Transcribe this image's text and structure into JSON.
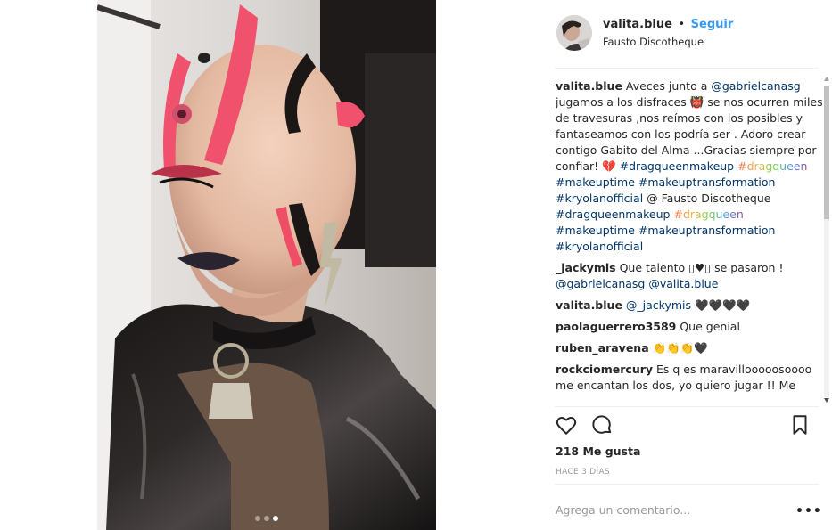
{
  "post": {
    "username": "valita.blue",
    "separator": "•",
    "follow_label": "Seguir",
    "location": "Fausto Discotheque",
    "carousel_dots": 3,
    "carousel_active": 3
  },
  "caption": {
    "user": "valita.blue",
    "segments": [
      {
        "t": " Aveces junto a "
      },
      {
        "t": "@gabrielcanasg",
        "k": "tag"
      },
      {
        "t": " jugamos a los disfraces 👹 se nos ocurren miles de travesuras ,nos reímos con los posibles y fantaseamos con los podría ser . Adoro crear contigo Gabito del Alma ...Gracias siempre por confiar! 💔 "
      },
      {
        "t": "#dragqueenmakeup",
        "k": "tag"
      },
      {
        "t": " "
      },
      {
        "t": "#dragqueen",
        "k": "rb"
      },
      {
        "t": " "
      },
      {
        "t": "#makeuptime",
        "k": "tag"
      },
      {
        "t": " "
      },
      {
        "t": "#makeuptransformation",
        "k": "tag"
      },
      {
        "t": " "
      },
      {
        "t": "#kryolanofficial",
        "k": "tag"
      },
      {
        "t": " @ Fausto Discotheque "
      },
      {
        "t": "#dragqueenmakeup",
        "k": "tag"
      },
      {
        "t": " "
      },
      {
        "t": "#dragqueen",
        "k": "rb"
      },
      {
        "t": " "
      },
      {
        "t": "#makeuptime",
        "k": "tag"
      },
      {
        "t": " "
      },
      {
        "t": "#makeuptransformation",
        "k": "tag"
      },
      {
        "t": " "
      },
      {
        "t": "#kryolanofficial",
        "k": "tag"
      }
    ]
  },
  "comments": [
    {
      "user": "_jackymis",
      "segments": [
        {
          "t": " Que talento ▯♥▯ se pasaron ! "
        },
        {
          "t": "@gabrielcanasg",
          "k": "tag"
        },
        {
          "t": " "
        },
        {
          "t": "@valita.blue",
          "k": "tag"
        }
      ]
    },
    {
      "user": "valita.blue",
      "segments": [
        {
          "t": " "
        },
        {
          "t": "@_jackymis",
          "k": "tag"
        },
        {
          "t": " 🖤🖤🖤🖤"
        }
      ]
    },
    {
      "user": "paolaguerrero3589",
      "segments": [
        {
          "t": " Que genial"
        }
      ]
    },
    {
      "user": "ruben_aravena",
      "segments": [
        {
          "t": " 👏👏👏🖤"
        }
      ]
    },
    {
      "user": "rockciomercury",
      "segments": [
        {
          "t": " Es q es maravillooooosoooo me encantan los dos, yo quiero jugar !! Me"
        }
      ]
    }
  ],
  "likes_label": "218 Me gusta",
  "time_ago": "HACE 3 DÍAS",
  "comment_box": {
    "placeholder": "Agrega un comentario...",
    "more_label": "•••"
  },
  "icons": {
    "like": "heart-icon",
    "comment": "comment-bubble-icon",
    "save": "bookmark-icon",
    "options": "more-options-icon"
  }
}
